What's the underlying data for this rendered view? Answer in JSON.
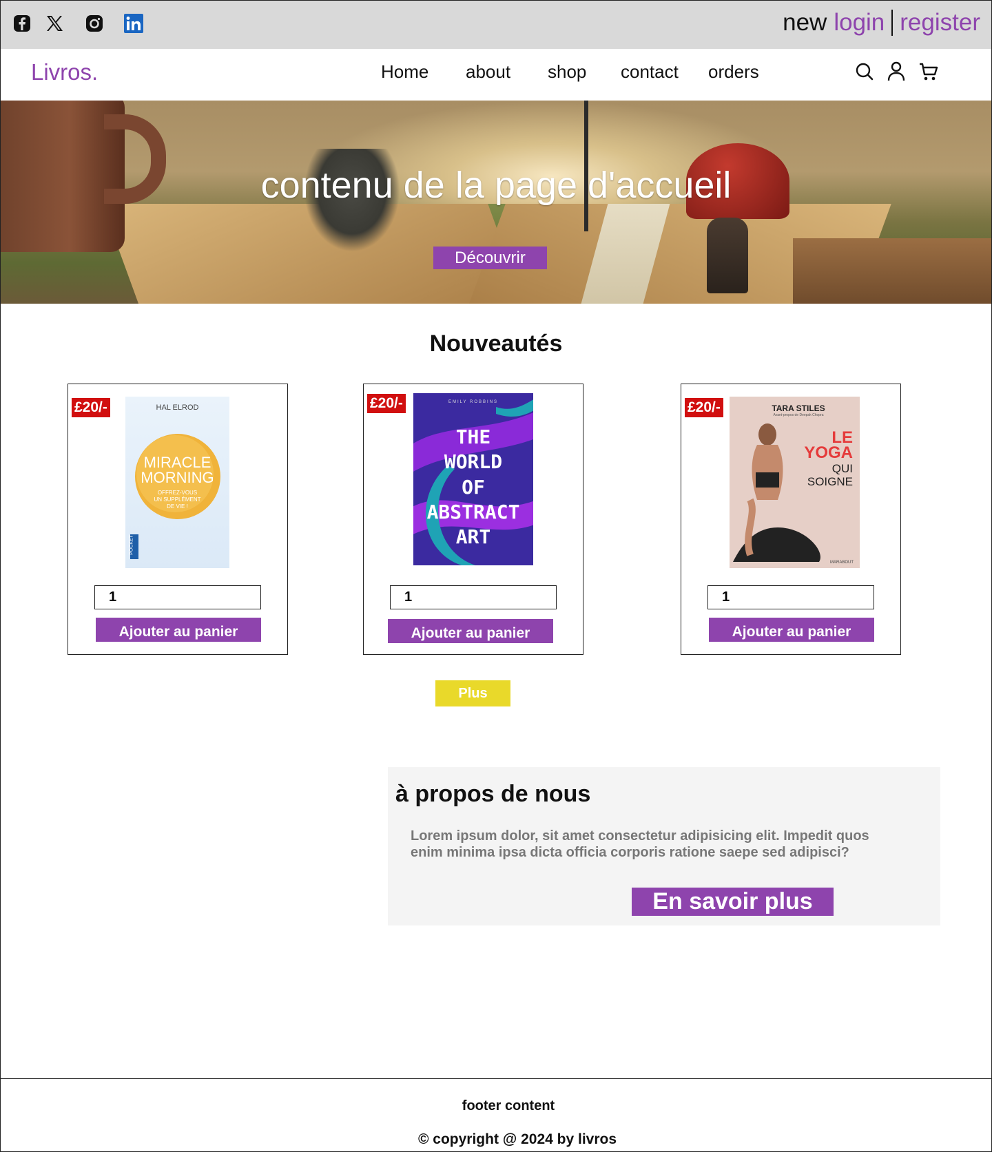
{
  "topbar": {
    "social": [
      {
        "icon": "facebook-icon"
      },
      {
        "icon": "x-twitter-icon"
      },
      {
        "icon": "instagram-icon"
      },
      {
        "icon": "linkedin-icon"
      }
    ],
    "auth": {
      "new": "new",
      "login": "login",
      "register": "register"
    }
  },
  "nav": {
    "logo": "Livros.",
    "menu": [
      "Home",
      "about",
      "shop",
      "contact",
      "orders"
    ],
    "icons": [
      "search-icon",
      "user-icon",
      "cart-icon"
    ]
  },
  "hero": {
    "title": "contenu de la page d'accueil",
    "button": "Découvrir"
  },
  "section": {
    "title": "Nouveautés"
  },
  "products": [
    {
      "price": "£20/-",
      "cover": {
        "author": "HAL ELROD",
        "title_line1": "MIRACLE",
        "title_line2": "MORNING",
        "subtitle_line1": "OFFREZ-VOUS",
        "subtitle_line2": "UN SUPPLÉMENT",
        "subtitle_line3": "DE VIE !",
        "publisher": "POCKET"
      },
      "qty": "1",
      "button": "Ajouter au panier"
    },
    {
      "price": "£20/-",
      "cover": {
        "author": "EMILY ROBBINS",
        "line1": "THE",
        "line2": "WORLD",
        "line3": "OF",
        "line4": "ABSTRACT",
        "line5": "ART"
      },
      "qty": "1",
      "button": "Ajouter au panier"
    },
    {
      "price": "£20/-",
      "cover": {
        "author": "TARA STILES",
        "foreword": "Avant-propos de Deepak Chopra",
        "line1": "LE",
        "line2": "YOGA",
        "line3": "QUI",
        "line4": "SOIGNE",
        "publisher": "MARABOUT"
      },
      "qty": "1",
      "button": "Ajouter au panier"
    }
  ],
  "plus_button": "Plus",
  "about": {
    "title": "à propos de nous",
    "text": "Lorem ipsum dolor, sit amet consectetur adipisicing elit. Impedit quos enim minima ipsa dicta officia corporis ratione saepe sed adipisci?",
    "button": "En savoir plus"
  },
  "footer": {
    "content": "footer content",
    "copyright": "© copyright @ 2024 by livros"
  },
  "colors": {
    "accent": "#8e44ad",
    "price_badge": "#d10f0f",
    "plus_button": "#e9d92a",
    "topbar": "#d9d9d9"
  }
}
